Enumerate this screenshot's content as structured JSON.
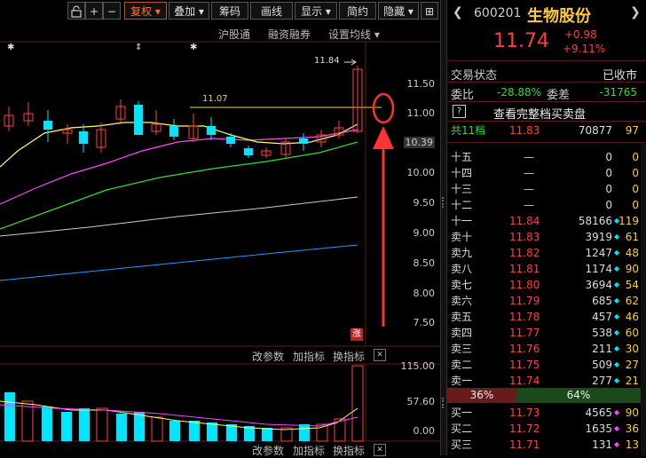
{
  "toolbar": {
    "lock_icon": "lock-icon",
    "plus": "+",
    "minus": "−",
    "fuquan": "复权",
    "diejia": "叠加",
    "choumaa": "筹码",
    "huaxian": "画线",
    "xianshi": "显示",
    "jianyue": "简约",
    "yincang": "隐藏",
    "collapse": "⊞"
  },
  "subtoolbar": {
    "hugutong": "沪股通",
    "rongzi": "融资融券",
    "junxian": "设置均线"
  },
  "price_axis": [
    "11.50",
    "11.00",
    "10.39",
    "10.00",
    "9.50",
    "9.00",
    "8.50",
    "8.00",
    "7.50"
  ],
  "annotations": {
    "high": "11.84",
    "line_label": "11.07",
    "limit_up": "涨",
    "stars": [
      "✱",
      "⇕",
      "✱"
    ]
  },
  "indicator_bar": {
    "params": "改参数",
    "add": "加指标",
    "switch": "换指标",
    "close": "✕"
  },
  "volume_axis": [
    "115.00",
    "57.60",
    "0.00"
  ],
  "bottom_bar": {
    "params": "改参数",
    "add": "加指标",
    "switch": "换指标",
    "close": "✕"
  },
  "quote": {
    "code": "600201",
    "name": "生物股份",
    "price": "11.74",
    "change": "+0.98",
    "pct": "+9.11%",
    "status_label": "交易状态",
    "status_value": "已收市",
    "weibi_label": "委比",
    "weibi_value": "-28.88%",
    "weicha_label": "委差",
    "weicha_value": "-31765",
    "help": "?",
    "full_book": "查看完整档买卖盘",
    "total_label": "共11档",
    "total_price": "11.83",
    "total_vol": "70877",
    "total_cnt": "97",
    "asks": [
      {
        "label": "十五",
        "price": "—",
        "vol": "0",
        "cnt": "0",
        "dot": ""
      },
      {
        "label": "十四",
        "price": "—",
        "vol": "0",
        "cnt": "0",
        "dot": ""
      },
      {
        "label": "十三",
        "price": "—",
        "vol": "0",
        "cnt": "0",
        "dot": ""
      },
      {
        "label": "十二",
        "price": "—",
        "vol": "0",
        "cnt": "0",
        "dot": ""
      },
      {
        "label": "十一",
        "price": "11.84",
        "vol": "58166",
        "cnt": "119",
        "dot": "◆"
      },
      {
        "label": "卖十",
        "price": "11.83",
        "vol": "3919",
        "cnt": "61",
        "dot": "◆"
      },
      {
        "label": "卖九",
        "price": "11.82",
        "vol": "1247",
        "cnt": "48",
        "dot": "◆"
      },
      {
        "label": "卖八",
        "price": "11.81",
        "vol": "1174",
        "cnt": "90",
        "dot": "◆"
      },
      {
        "label": "卖七",
        "price": "11.80",
        "vol": "3694",
        "cnt": "54",
        "dot": "◆"
      },
      {
        "label": "卖六",
        "price": "11.79",
        "vol": "685",
        "cnt": "62",
        "dot": "◆"
      },
      {
        "label": "卖五",
        "price": "11.78",
        "vol": "457",
        "cnt": "46",
        "dot": "◆"
      },
      {
        "label": "卖四",
        "price": "11.77",
        "vol": "538",
        "cnt": "60",
        "dot": "◆"
      },
      {
        "label": "卖三",
        "price": "11.76",
        "vol": "211",
        "cnt": "30",
        "dot": "◆"
      },
      {
        "label": "卖二",
        "price": "11.75",
        "vol": "509",
        "cnt": "27",
        "dot": "◆"
      },
      {
        "label": "卖一",
        "price": "11.74",
        "vol": "277",
        "cnt": "21",
        "dot": "◆"
      }
    ],
    "ratio_sell": "36%",
    "ratio_buy": "64%",
    "bids": [
      {
        "label": "买一",
        "price": "11.73",
        "vol": "4565",
        "cnt": "90",
        "dot": "◆"
      },
      {
        "label": "买二",
        "price": "11.72",
        "vol": "1635",
        "cnt": "36",
        "dot": "◆"
      },
      {
        "label": "买三",
        "price": "11.71",
        "vol": "131",
        "cnt": "13",
        "dot": "◆"
      }
    ]
  },
  "colors": {
    "up": "#ff4040",
    "down": "#00e5ff",
    "ma5": "#ffff66",
    "ma10": "#ff44ff",
    "ma20": "#33dd33",
    "ma60": "#cccccc",
    "ma120": "#2299ff",
    "arrow": "#ff3333"
  }
}
